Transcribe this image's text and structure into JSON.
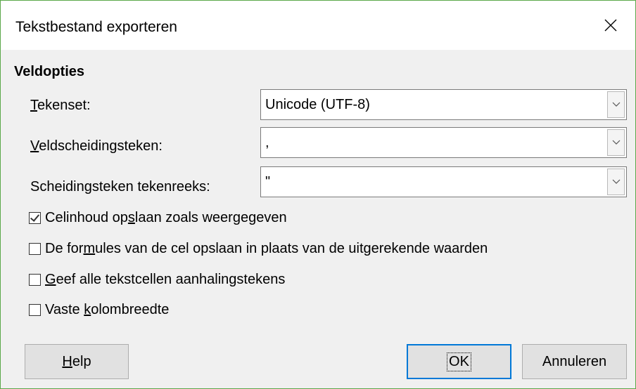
{
  "window": {
    "title": "Tekstbestand exporteren",
    "close_icon": "close-icon"
  },
  "section": {
    "title": "Veldopties"
  },
  "fields": {
    "charset": {
      "label_u": "T",
      "label_rest": "ekenset:",
      "value": "Unicode (UTF-8)"
    },
    "field_sep": {
      "label_u": "V",
      "label_rest": "eldscheidingsteken:",
      "value": ","
    },
    "string_sep": {
      "label_pre": "Scheidin",
      "label_u": "g",
      "label_rest": "steken tekenreeks:",
      "value": "\""
    }
  },
  "options": {
    "save_as_shown": {
      "pre": "Celinhoud op",
      "u": "s",
      "rest": "laan zoals weergegeven",
      "checked": true
    },
    "save_formulas": {
      "pre": "De for",
      "u": "m",
      "rest": "ules van de cel opslaan in plaats van de uitgerekende waarden",
      "checked": false
    },
    "quote_all": {
      "pre": "",
      "u": "G",
      "rest": "eef alle tekstcellen aanhalingstekens",
      "checked": false
    },
    "fixed_width": {
      "pre": "Vaste ",
      "u": "k",
      "rest": "olombreedte",
      "checked": false
    }
  },
  "buttons": {
    "help_u": "H",
    "help_rest": "elp",
    "ok": "OK",
    "cancel": "Annuleren"
  }
}
